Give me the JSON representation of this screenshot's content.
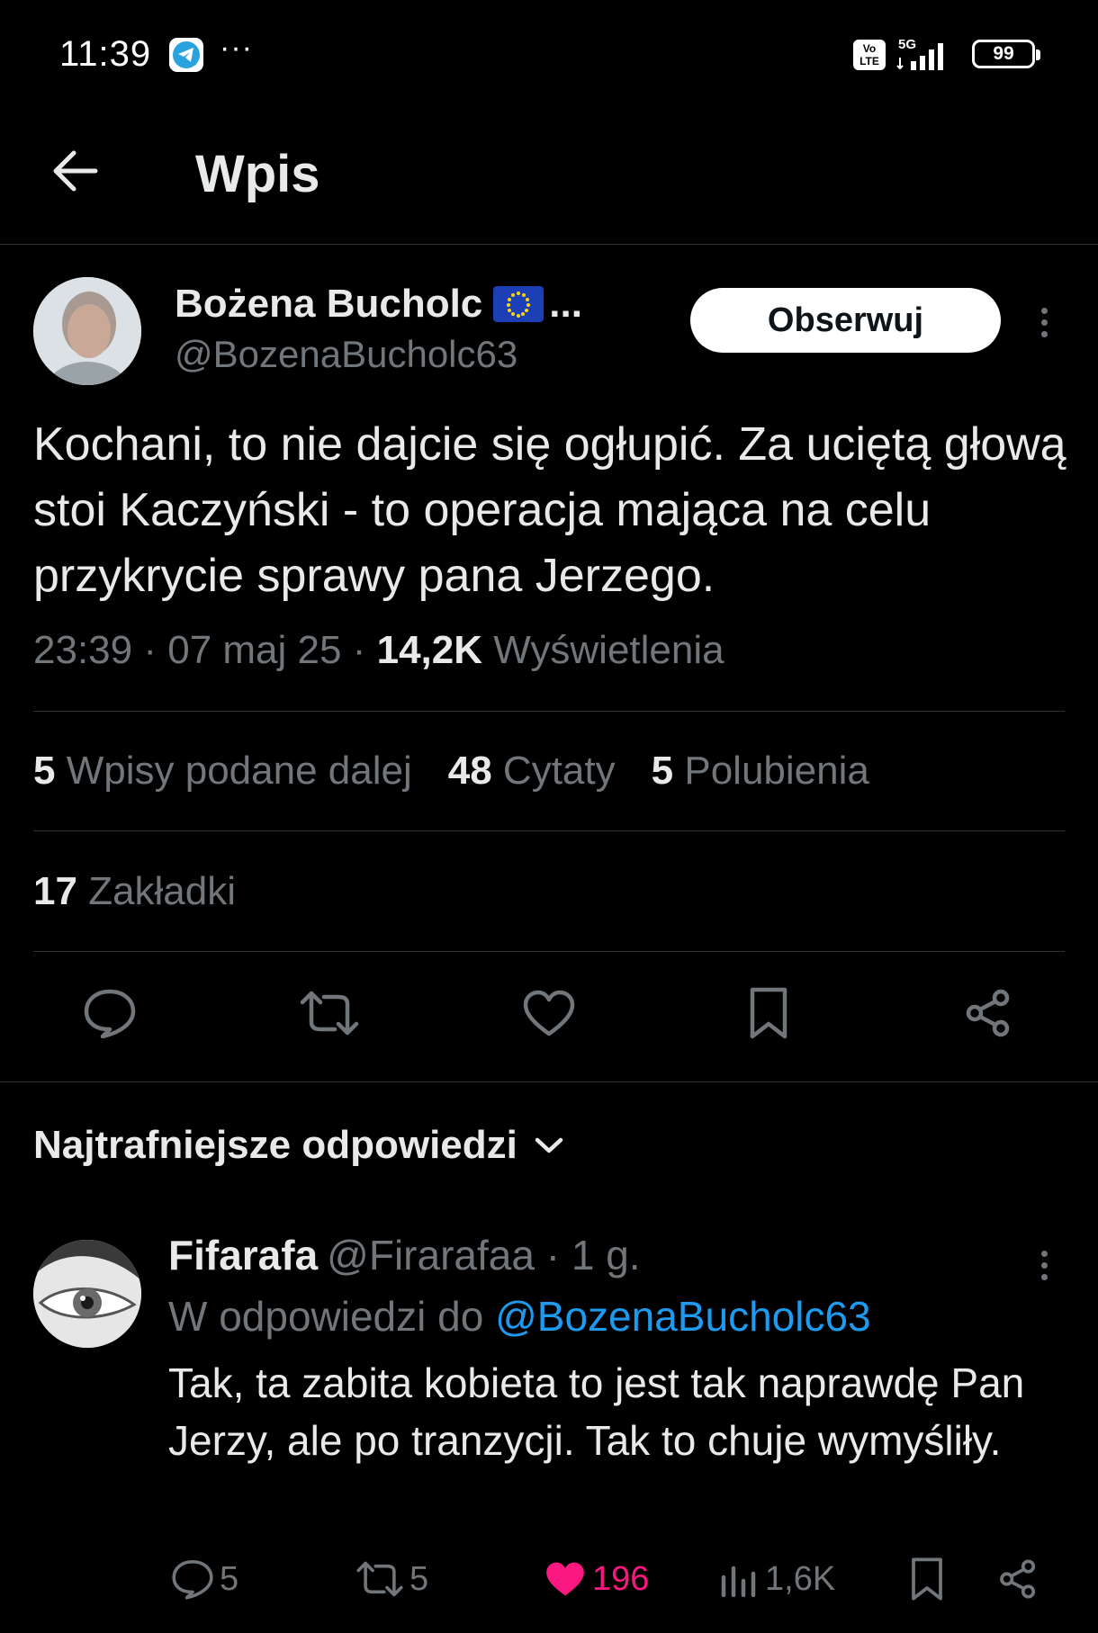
{
  "status_bar": {
    "time": "11:39",
    "dots": "···",
    "network": "5G",
    "volte": "Vo LTE",
    "battery": "99"
  },
  "header": {
    "title": "Wpis"
  },
  "tweet": {
    "author_name": "Bożena Bucholc",
    "name_ellipsis": "...",
    "handle": "@BozenaBucholc63",
    "follow_label": "Obserwuj",
    "text": "Kochani, to nie dajcie się ogłupić. Za uciętą głową stoi Kaczyński - to operacja mająca na celu przykrycie sprawy pana Jerzego.",
    "time": "23:39",
    "date": "07 maj 25",
    "sep": "·",
    "views_count": "14,2K",
    "views_label": "Wyświetlenia",
    "stats": {
      "reposts_count": "5",
      "reposts_label": "Wpisy podane dalej",
      "quotes_count": "48",
      "quotes_label": "Cytaty",
      "likes_count": "5",
      "likes_label": "Polubienia",
      "bookmarks_count": "17",
      "bookmarks_label": "Zakładki"
    }
  },
  "replies_section": {
    "title": "Najtrafniejsze odpowiedzi"
  },
  "reply": {
    "name": "Fifarafa",
    "handle": "@Firarafaa",
    "sep": " · ",
    "time": "1 g.",
    "reply_to_prefix": "W odpowiedzi do ",
    "reply_to_handle": "@BozenaBucholc63",
    "text": "Tak, ta zabita kobieta to jest tak naprawdę Pan Jerzy, ale po tranzycji. Tak to chuje wymyśliły.",
    "replies_count": "5",
    "reposts_count": "5",
    "likes_count": "196",
    "views_count": "1,6K"
  },
  "colors": {
    "background": "#000000",
    "text_primary": "#e7e9ea",
    "text_secondary": "#71767b",
    "link": "#1d9bf0",
    "like": "#f91880",
    "divider": "#2f3336"
  },
  "icons": {
    "back": "arrow-left-icon",
    "more": "more-vertical-icon",
    "reply": "comment-icon",
    "repost": "repost-icon",
    "like": "heart-icon",
    "bookmark": "bookmark-icon",
    "share": "share-icon",
    "views": "views-icon",
    "chevron": "chevron-down-icon"
  }
}
